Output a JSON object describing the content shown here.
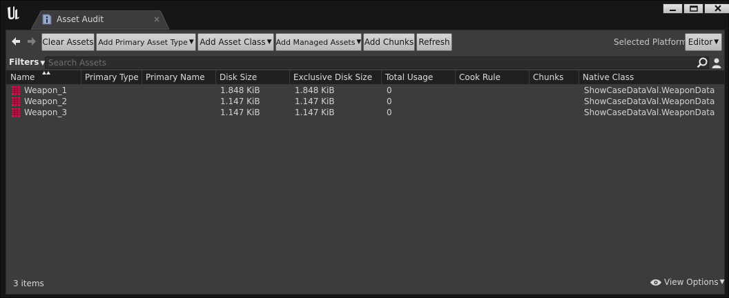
{
  "window": {
    "logo": "unreal-engine-logo",
    "tab": {
      "label": "Asset Audit",
      "icon": "info-icon",
      "close": "×"
    },
    "controls": [
      "minimize",
      "maximize",
      "close"
    ]
  },
  "toolbar": {
    "back_icon": "arrow-left-icon",
    "forward_icon": "arrow-right-icon",
    "buttons": [
      {
        "label": "Clear Assets",
        "dropdown": false
      },
      {
        "label": "Add Primary Asset Type",
        "dropdown": true
      },
      {
        "label": "Add Asset Class",
        "dropdown": true
      },
      {
        "label": "Add Managed Assets",
        "dropdown": true
      },
      {
        "label": "Add Chunks",
        "dropdown": false
      },
      {
        "label": "Refresh",
        "dropdown": false
      }
    ],
    "platform_label": "Selected Platform:",
    "platform_value": "Editor"
  },
  "filters": {
    "label": "Filters",
    "search_placeholder": "Search Assets",
    "search_value": ""
  },
  "table": {
    "columns": [
      "Name",
      "Primary Type",
      "Primary Name",
      "Disk Size",
      "Exclusive Disk Size",
      "Total Usage",
      "Cook Rule",
      "Chunks",
      "Native Class"
    ],
    "rows": [
      {
        "name": "Weapon_1",
        "primary_type": "",
        "primary_name": "",
        "disk_size": "1.848 KiB",
        "exclusive_disk_size": "1.848 KiB",
        "total_usage": "0",
        "cook_rule": "",
        "chunks": "",
        "native_class": "ShowCaseDataVal.WeaponData"
      },
      {
        "name": "Weapon_2",
        "primary_type": "",
        "primary_name": "",
        "disk_size": "1.147 KiB",
        "exclusive_disk_size": "1.147 KiB",
        "total_usage": "0",
        "cook_rule": "",
        "chunks": "",
        "native_class": "ShowCaseDataVal.WeaponData"
      },
      {
        "name": "Weapon_3",
        "primary_type": "",
        "primary_name": "",
        "disk_size": "1.147 KiB",
        "exclusive_disk_size": "1.147 KiB",
        "total_usage": "0",
        "cook_rule": "",
        "chunks": "",
        "native_class": "ShowCaseDataVal.WeaponData"
      }
    ]
  },
  "footer": {
    "item_count": "3 items",
    "view_options_label": "View Options",
    "view_options_icon": "eye-icon"
  },
  "colors": {
    "panel_bg": "#3c3c3c",
    "header_bg": "#202020",
    "asset_icon": "#d0184f",
    "button_bg": "#c8c8c8"
  }
}
